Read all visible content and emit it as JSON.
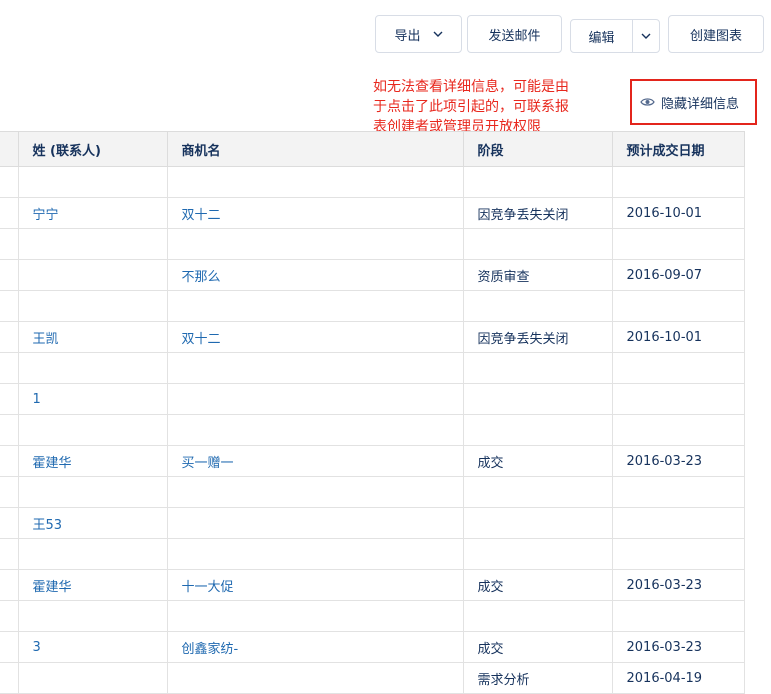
{
  "toolbar": {
    "export_label": "导出",
    "send_mail_label": "发送邮件",
    "edit_label": "编辑",
    "create_chart_label": "创建图表"
  },
  "annotation": {
    "line1": "如无法查看详细信息，可能是由",
    "line2": "于点击了此项引起的，可联系报",
    "line3": "表创建者或管理员开放权限",
    "color": "#e8281e"
  },
  "detail_toggle": {
    "label": "隐藏详细信息",
    "icon": "eye-icon"
  },
  "table": {
    "headers": [
      "",
      "姓 (联系人)",
      "商机名",
      "阶段",
      "预计成交日期"
    ],
    "rows": [
      {
        "contact": "",
        "opportunity": "",
        "stage": "",
        "date": ""
      },
      {
        "contact": "宁宁",
        "opportunity": "双十二",
        "stage": "因竞争丢失关闭",
        "date": "2016-10-01"
      },
      {
        "contact": "",
        "opportunity": "",
        "stage": "",
        "date": ""
      },
      {
        "contact": "",
        "opportunity": "不那么",
        "stage": "资质审查",
        "date": "2016-09-07"
      },
      {
        "contact": "",
        "opportunity": "",
        "stage": "",
        "date": ""
      },
      {
        "contact": "王凯",
        "opportunity": "双十二",
        "stage": "因竞争丢失关闭",
        "date": "2016-10-01"
      },
      {
        "contact": "",
        "opportunity": "",
        "stage": "",
        "date": ""
      },
      {
        "contact": "1",
        "opportunity": "",
        "stage": "",
        "date": ""
      },
      {
        "contact": "",
        "opportunity": "",
        "stage": "",
        "date": ""
      },
      {
        "contact": "霍建华",
        "opportunity": "买一赠一",
        "stage": "成交",
        "date": "2016-03-23"
      },
      {
        "contact": "",
        "opportunity": "",
        "stage": "",
        "date": ""
      },
      {
        "contact": "王53",
        "opportunity": "",
        "stage": "",
        "date": ""
      },
      {
        "contact": "",
        "opportunity": "",
        "stage": "",
        "date": ""
      },
      {
        "contact": "霍建华",
        "opportunity": "十一大促",
        "stage": "成交",
        "date": "2016-03-23"
      },
      {
        "contact": "",
        "opportunity": "",
        "stage": "",
        "date": ""
      },
      {
        "contact": "3",
        "opportunity": "创鑫家纺-",
        "stage": "成交",
        "date": "2016-03-23"
      },
      {
        "contact": "",
        "opportunity": "",
        "stage": "需求分析",
        "date": "2016-04-19"
      }
    ]
  },
  "colors": {
    "link": "#1f69b0",
    "text": "#16325c",
    "header_bg": "#f3f3f3",
    "highlight_border": "#e3251c"
  }
}
